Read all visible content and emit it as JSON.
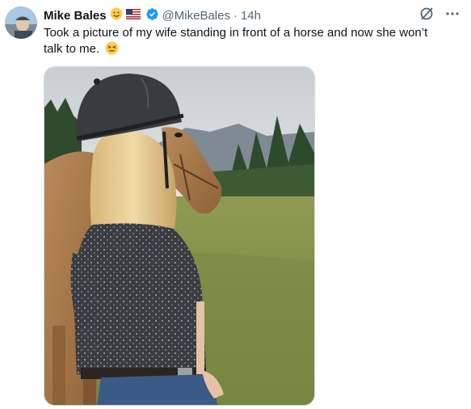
{
  "tweet": {
    "display_name": "Mike Bales",
    "handle": "@MikeBales",
    "separator": "·",
    "time": "14h",
    "text": "Took a picture of my wife standing in front of a horse and now she won’t talk to me.",
    "badges": [
      "smile-emoji",
      "us-flag-emoji",
      "verified-badge-icon"
    ],
    "text_emoji": "persevering-face-emoji",
    "icons": [
      "grok-icon",
      "more-icon"
    ]
  },
  "colors": {
    "text_primary": "#0f1419",
    "text_secondary": "#536471",
    "verified_blue": "#1d9bf0",
    "border": "#cfd9de"
  }
}
